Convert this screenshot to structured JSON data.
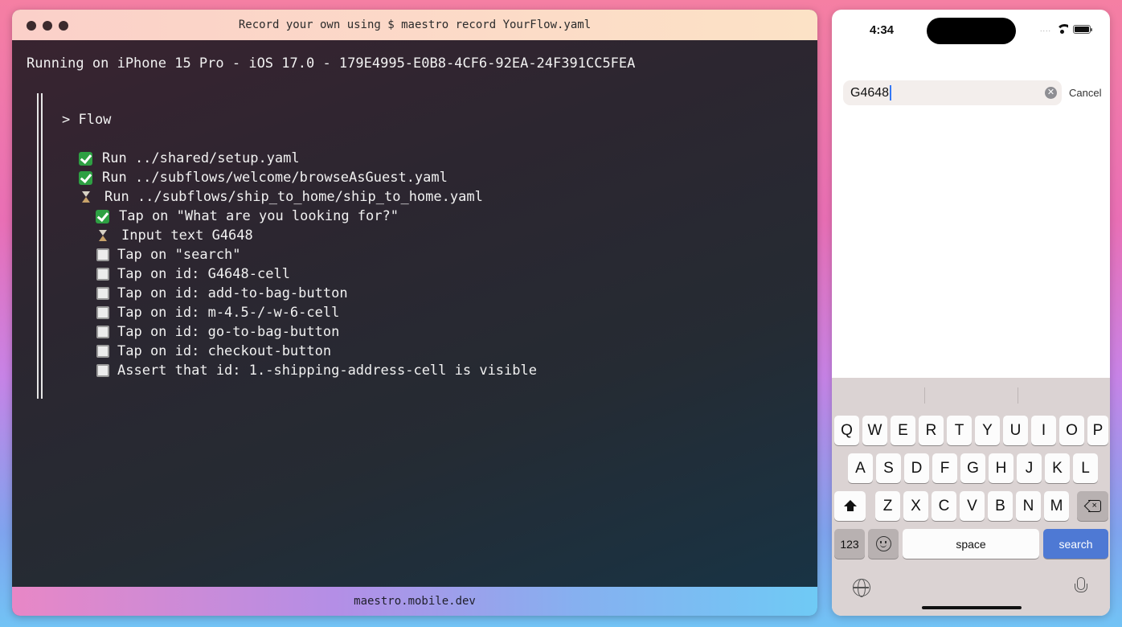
{
  "terminal": {
    "title": "Record your own using $ maestro record YourFlow.yaml",
    "run_line": "Running on iPhone 15 Pro - iOS 17.0 - 179E4995-E0B8-4CF6-92EA-24F391CC5FEA",
    "flow_label": "> Flow",
    "steps": [
      {
        "status": "done",
        "text": "Run ../shared/setup.yaml"
      },
      {
        "status": "done",
        "text": "Run ../subflows/welcome/browseAsGuest.yaml"
      },
      {
        "status": "running",
        "text": "Run ../subflows/ship_to_home/ship_to_home.yaml"
      },
      {
        "status": "done",
        "text": "Tap on \"What are you looking for?\""
      },
      {
        "status": "running",
        "text": "Input text G4648"
      },
      {
        "status": "pending",
        "text": "Tap on \"search\""
      },
      {
        "status": "pending",
        "text": "Tap on id: G4648-cell"
      },
      {
        "status": "pending",
        "text": "Tap on id: add-to-bag-button"
      },
      {
        "status": "pending",
        "text": "Tap on id: m-4.5-/-w-6-cell"
      },
      {
        "status": "pending",
        "text": "Tap on id: go-to-bag-button"
      },
      {
        "status": "pending",
        "text": "Tap on id: checkout-button"
      },
      {
        "status": "pending",
        "text": "Assert that id: 1.-shipping-address-cell is visible"
      }
    ],
    "footer": "maestro.mobile.dev"
  },
  "phone": {
    "status_time": "4:34",
    "status_dots": "....",
    "search_value": "G4648",
    "cancel_label": "Cancel",
    "clear_glyph": "✕",
    "keyboard": {
      "row1": [
        "Q",
        "W",
        "E",
        "R",
        "T",
        "Y",
        "U",
        "I",
        "O",
        "P"
      ],
      "row2": [
        "A",
        "S",
        "D",
        "F",
        "G",
        "H",
        "J",
        "K",
        "L"
      ],
      "row3": [
        "Z",
        "X",
        "C",
        "V",
        "B",
        "N",
        "M"
      ],
      "numbers_label": "123",
      "space_label": "space",
      "search_label": "search"
    }
  },
  "colors": {
    "check_green": "#2ea043",
    "search_key_blue": "#4e79d4",
    "caret_blue": "#3478f6"
  }
}
